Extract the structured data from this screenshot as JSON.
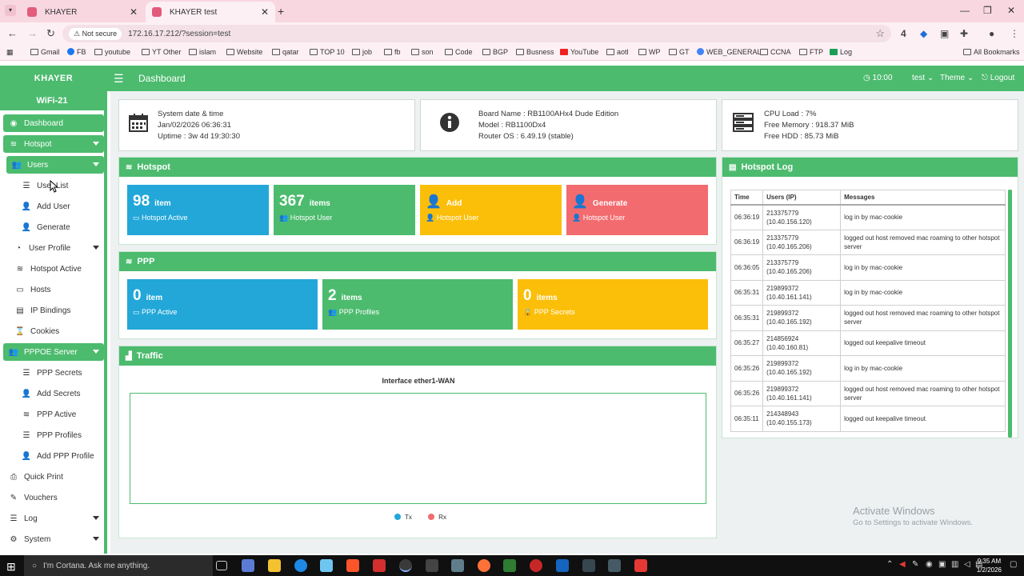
{
  "browser": {
    "tabs": [
      {
        "title": "KHAYER",
        "active": false
      },
      {
        "title": "KHAYER test",
        "active": true
      }
    ],
    "security_label": "Not secure",
    "url": "172.16.17.212/?session=test",
    "badge": "4",
    "bookmarks": [
      "Gmail",
      "FB",
      "youtube",
      "YT Other",
      "islam",
      "Website",
      "qatar",
      "TOP 10",
      "job",
      "fb",
      "son",
      "Code",
      "BGP",
      "Busness",
      "YouTube",
      "aotl",
      "WP",
      "GT",
      "WEB_GENERAL",
      "CCNA",
      "FTP",
      "Log"
    ],
    "all_bookmarks": "All Bookmarks"
  },
  "header": {
    "brand": "KHAYER",
    "title": "Dashboard",
    "time": "10:00",
    "user": "test",
    "theme": "Theme",
    "logout": "Logout"
  },
  "sidebar": {
    "subtitle": "WiFi-21",
    "items": [
      {
        "label": "Dashboard",
        "icon": "dashboard-icon"
      },
      {
        "label": "Hotspot",
        "icon": "wifi-icon"
      },
      {
        "label": "Users",
        "icon": "users-icon"
      },
      {
        "label": "User List",
        "icon": "list-icon"
      },
      {
        "label": "Add User",
        "icon": "user-plus-icon"
      },
      {
        "label": "Generate",
        "icon": "user-plus-icon"
      },
      {
        "label": "User Profile",
        "icon": "pie-icon"
      },
      {
        "label": "Hotspot Active",
        "icon": "wifi-icon"
      },
      {
        "label": "Hosts",
        "icon": "laptop-icon"
      },
      {
        "label": "IP Bindings",
        "icon": "address-book-icon"
      },
      {
        "label": "Cookies",
        "icon": "hourglass-icon"
      },
      {
        "label": "PPPOE Server",
        "icon": "users-icon"
      },
      {
        "label": "PPP Secrets",
        "icon": "list-icon"
      },
      {
        "label": "Add Secrets",
        "icon": "user-plus-icon"
      },
      {
        "label": "PPP Active",
        "icon": "wifi-icon"
      },
      {
        "label": "PPP Profiles",
        "icon": "list-icon"
      },
      {
        "label": "Add PPP Profile",
        "icon": "user-plus-icon"
      },
      {
        "label": "Quick Print",
        "icon": "print-icon"
      },
      {
        "label": "Vouchers",
        "icon": "ticket-icon"
      },
      {
        "label": "Log",
        "icon": "list-icon"
      },
      {
        "label": "System",
        "icon": "gear-icon"
      }
    ]
  },
  "system": {
    "date_label": "System date & time",
    "date_value": "Jan/02/2026 06:36:31",
    "uptime": "Uptime : 3w 4d 19:30:30",
    "board": "Board Name : RB1100AHx4 Dude Edition",
    "model": "Model : RB1100Dx4",
    "os": "Router OS : 6.49.19 (stable)",
    "cpu": "CPU Load : 7%",
    "memory": "Free Memory : 918.37 MiB",
    "hdd": "Free HDD : 85.73 MiB"
  },
  "hotspot": {
    "title": "Hotspot",
    "tiles": [
      {
        "num": "98",
        "unit": "item",
        "label": "Hotspot Active"
      },
      {
        "num": "367",
        "unit": "items",
        "label": "Hotspot User"
      },
      {
        "num": "",
        "unit": "Add",
        "label": "Hotspot User"
      },
      {
        "num": "",
        "unit": "Generate",
        "label": "Hotspot User"
      }
    ]
  },
  "ppp": {
    "title": "PPP",
    "tiles": [
      {
        "num": "0",
        "unit": "item",
        "label": "PPP Active"
      },
      {
        "num": "2",
        "unit": "items",
        "label": "PPP Profiles"
      },
      {
        "num": "0",
        "unit": "items",
        "label": "PPP Secrets"
      }
    ]
  },
  "traffic": {
    "title": "Traffic",
    "interface": "Interface ether1-WAN",
    "legend": [
      {
        "name": "Tx",
        "color": "#22a7d8"
      },
      {
        "name": "Rx",
        "color": "#f26b6f"
      }
    ]
  },
  "hotspot_log": {
    "title": "Hotspot Log",
    "columns": [
      "Time",
      "Users (IP)",
      "Messages"
    ],
    "rows": [
      {
        "time": "06:36:19",
        "user": "213375779",
        "ip": "(10.40.156.120)",
        "msg": "log in by mac-cookie"
      },
      {
        "time": "06:36:19",
        "user": "213375779",
        "ip": "(10.40.165.206)",
        "msg": "logged out host removed mac roaming to other hotspot server"
      },
      {
        "time": "06:36:05",
        "user": "213375779",
        "ip": "(10.40.165.206)",
        "msg": "log in by mac-cookie"
      },
      {
        "time": "06:35:31",
        "user": "219899372",
        "ip": "(10.40.161.141)",
        "msg": "log in by mac-cookie"
      },
      {
        "time": "06:35:31",
        "user": "219899372",
        "ip": "(10.40.165.192)",
        "msg": "logged out host removed mac roaming to other hotspot server"
      },
      {
        "time": "06:35:27",
        "user": "214856924",
        "ip": "(10.40.160.81)",
        "msg": "logged out keepalive timeout"
      },
      {
        "time": "06:35:26",
        "user": "219899372",
        "ip": "(10.40.165.192)",
        "msg": "log in by mac-cookie"
      },
      {
        "time": "06:35:26",
        "user": "219899372",
        "ip": "(10.40.161.141)",
        "msg": "logged out host removed mac roaming to other hotspot server"
      },
      {
        "time": "06:35:11",
        "user": "214348943",
        "ip": "(10.40.155.173)",
        "msg": "logged out keepalive timeout"
      }
    ]
  },
  "watermark": {
    "title": "Activate Windows",
    "subtitle": "Go to Settings to activate Windows."
  },
  "taskbar": {
    "search_placeholder": "I'm Cortana. Ask me anything.",
    "time": "9:35 AM",
    "date": "1/2/2026"
  }
}
